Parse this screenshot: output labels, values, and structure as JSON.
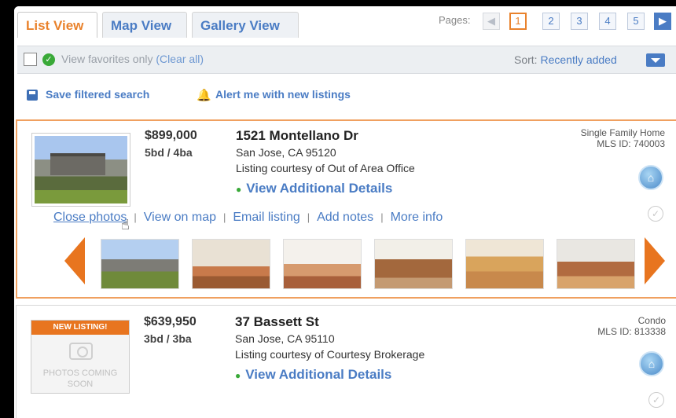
{
  "tabs": [
    {
      "label": "List View",
      "active": true
    },
    {
      "label": "Map View",
      "active": false
    },
    {
      "label": "Gallery View",
      "active": false
    }
  ],
  "pagination": {
    "label": "Pages:",
    "pages": [
      "1",
      "2",
      "3",
      "4",
      "5"
    ],
    "current": "1",
    "prev_icon": "◀",
    "next_icon": "▶"
  },
  "filter": {
    "favorites_label": "View favorites only",
    "clear_label": "(Clear all)",
    "sort_label": "Sort:",
    "sort_value": "Recently added"
  },
  "actions": {
    "save_label": "Save filtered search",
    "alert_label": "Alert me with new listings"
  },
  "listings": [
    {
      "price": "$899,000",
      "beds_baths": "5bd / 4ba",
      "address": "1521 Montellano Dr",
      "city": "San Jose, CA  95120",
      "courtesy": "Listing courtesy of Out of Area Office",
      "details_label": "View Additional Details",
      "type": "Single Family Home",
      "mls": "MLS ID: 740003",
      "links": [
        "Close photos",
        "View on map",
        "Email listing",
        "Add notes",
        "More info"
      ]
    },
    {
      "badge": "NEW LISTING!",
      "no_photo_text": "PHOTOS COMING SOON",
      "price": "$639,950",
      "beds_baths": "3bd / 3ba",
      "address": "37 Bassett St",
      "city": "San Jose, CA  95110",
      "courtesy": "Listing courtesy of Courtesy Brokerage",
      "details_label": "View Additional Details",
      "type": "Condo",
      "mls": "MLS ID: 813338"
    }
  ],
  "colors": {
    "accent": "#e9822c",
    "link": "#4a7cc4",
    "highlight_border": "#f0a060"
  }
}
